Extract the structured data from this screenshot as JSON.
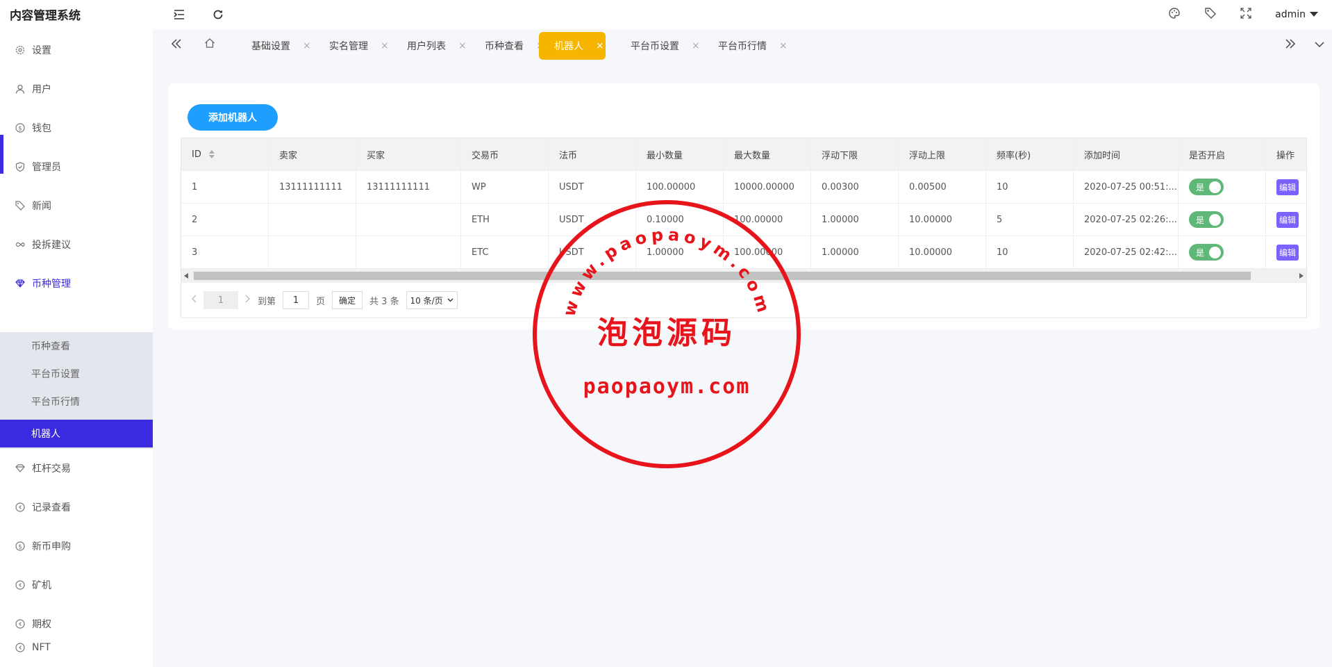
{
  "app": {
    "title": "内容管理系统",
    "user": "admin"
  },
  "header": {
    "icons": [
      "menu-fold-icon",
      "refresh-icon",
      "theme-icon",
      "tag-icon",
      "fullscreen-icon"
    ]
  },
  "sidebar": {
    "items": [
      {
        "label": "设置",
        "icon": "gear-icon"
      },
      {
        "label": "用户",
        "icon": "user-icon"
      },
      {
        "label": "钱包",
        "icon": "dollar-icon"
      },
      {
        "label": "管理员",
        "icon": "shield-icon"
      },
      {
        "label": "新闻",
        "icon": "tag-icon"
      },
      {
        "label": "投拆建议",
        "icon": "infinity-icon"
      },
      {
        "label": "币种管理",
        "icon": "diamond-icon"
      },
      {
        "label": "杠杆交易",
        "icon": "diamond-icon"
      },
      {
        "label": "记录查看",
        "icon": "circle-arrow-icon"
      },
      {
        "label": "新币申购",
        "icon": "dollar-icon"
      },
      {
        "label": "矿机",
        "icon": "circle-arrow-icon"
      },
      {
        "label": "期权",
        "icon": "circle-arrow-icon"
      },
      {
        "label": "NFT",
        "icon": "circle-arrow-icon"
      }
    ],
    "submenu": [
      {
        "label": "币种查看"
      },
      {
        "label": "平台币设置"
      },
      {
        "label": "平台币行情"
      },
      {
        "label": "机器人"
      }
    ]
  },
  "tabs": [
    {
      "label": "基础设置"
    },
    {
      "label": "实名管理"
    },
    {
      "label": "用户列表"
    },
    {
      "label": "币种查看"
    },
    {
      "label": "机器人"
    },
    {
      "label": "平台币设置"
    },
    {
      "label": "平台币行情"
    }
  ],
  "tab_close": "×",
  "main": {
    "add_button": "添加机器人",
    "table": {
      "headers": [
        "ID",
        "卖家",
        "买家",
        "交易币",
        "法币",
        "最小数量",
        "最大数量",
        "浮动下限",
        "浮动上限",
        "频率(秒)",
        "添加时间",
        "是否开启",
        "操作"
      ],
      "rows": [
        [
          "1",
          "13111111111",
          "13111111111",
          "WP",
          "USDT",
          "100.00000",
          "10000.00000",
          "0.00300",
          "0.00500",
          "10",
          "2020-07-25 00:51:..."
        ],
        [
          "2",
          "",
          "",
          "ETH",
          "USDT",
          "0.10000",
          "100.00000",
          "1.00000",
          "10.00000",
          "5",
          "2020-07-25 02:26:..."
        ],
        [
          "3",
          "",
          "",
          "ETC",
          "USDT",
          "1.00000",
          "100.00000",
          "1.00000",
          "10.00000",
          "10",
          "2020-07-25 02:42:..."
        ]
      ],
      "switch_label": "是",
      "edit_label": "编辑"
    },
    "pagination": {
      "current": "1",
      "goto_label": "到第",
      "goto_value": "1",
      "page_unit": "页",
      "confirm": "确定",
      "total": "共 3 条",
      "page_size": "10 条/页"
    }
  },
  "watermark": {
    "url": "www.paopaoym.com",
    "name": "泡泡源码",
    "domain": "paopaoym.com",
    "color": "#e8141b"
  }
}
